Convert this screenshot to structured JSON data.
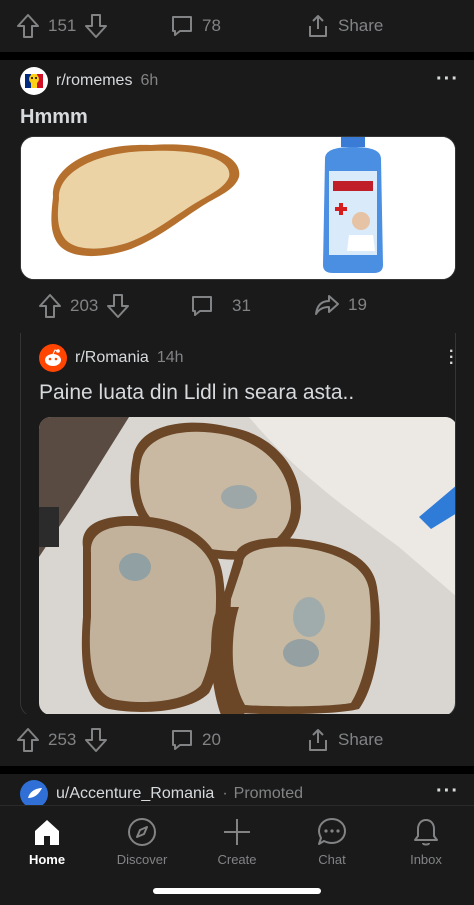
{
  "top_actions": {
    "upvotes": "151",
    "comments": "78",
    "share_label": "Share"
  },
  "post1": {
    "subreddit": "r/romemes",
    "age": "6h",
    "title": "Hmmm",
    "image_caption": "",
    "actions": {
      "upvotes": "203",
      "comments": "31",
      "shares": "19"
    }
  },
  "crosspost": {
    "subreddit": "r/Romania",
    "age": "14h",
    "title": "Paine luata din Lidl in seara asta.."
  },
  "post2_actions": {
    "upvotes": "253",
    "comments": "20",
    "share_label": "Share"
  },
  "promoted": {
    "user": "u/Accenture_Romania",
    "separator": "·",
    "label": "Promoted"
  },
  "tabbar": {
    "tabs": [
      {
        "label": "Home",
        "icon": "home-icon",
        "active": true
      },
      {
        "label": "Discover",
        "icon": "compass-icon",
        "active": false
      },
      {
        "label": "Create",
        "icon": "plus-icon",
        "active": false
      },
      {
        "label": "Chat",
        "icon": "chat-icon",
        "active": false
      },
      {
        "label": "Inbox",
        "icon": "bell-icon",
        "active": false
      }
    ]
  },
  "colors": {
    "background": "#1a1a1b",
    "text": "#d7dadc",
    "muted": "#818384",
    "reddit_orange": "#ff4500"
  }
}
